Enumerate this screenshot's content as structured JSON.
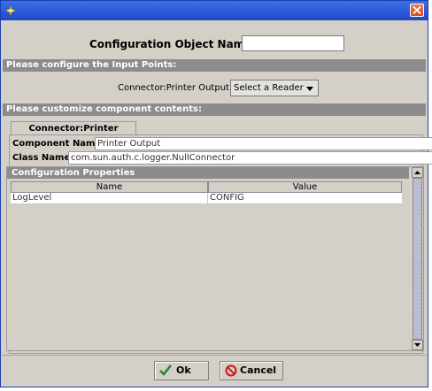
{
  "window": {
    "title": "",
    "icon": "app-icon",
    "close_icon": "close-icon"
  },
  "config": {
    "label": "Configuration Object Name:",
    "value": "",
    "placeholder": ""
  },
  "input_points": {
    "header": "Please configure the Input Points:",
    "connector_label": "Connector:Printer Output",
    "reader_select": "Select a Reader"
  },
  "component": {
    "header": "Please customize component contents:",
    "tab_label": "Connector:Printer Output",
    "name_label": "Component Name:",
    "name_value": "Printer Output",
    "class_label": "Class Name:",
    "class_value": "com.sun.auth.c.logger.NullConnector"
  },
  "properties": {
    "header": "Configuration Properties",
    "columns": [
      "Name",
      "Value"
    ],
    "rows": [
      {
        "name": "LogLevel",
        "value": "CONFIG"
      }
    ]
  },
  "buttons": {
    "ok": "Ok",
    "cancel": "Cancel"
  },
  "colors": {
    "titlebar": "#2b58d6",
    "section_header": "#8c8c8c",
    "window_bg": "#d4d0c8"
  }
}
